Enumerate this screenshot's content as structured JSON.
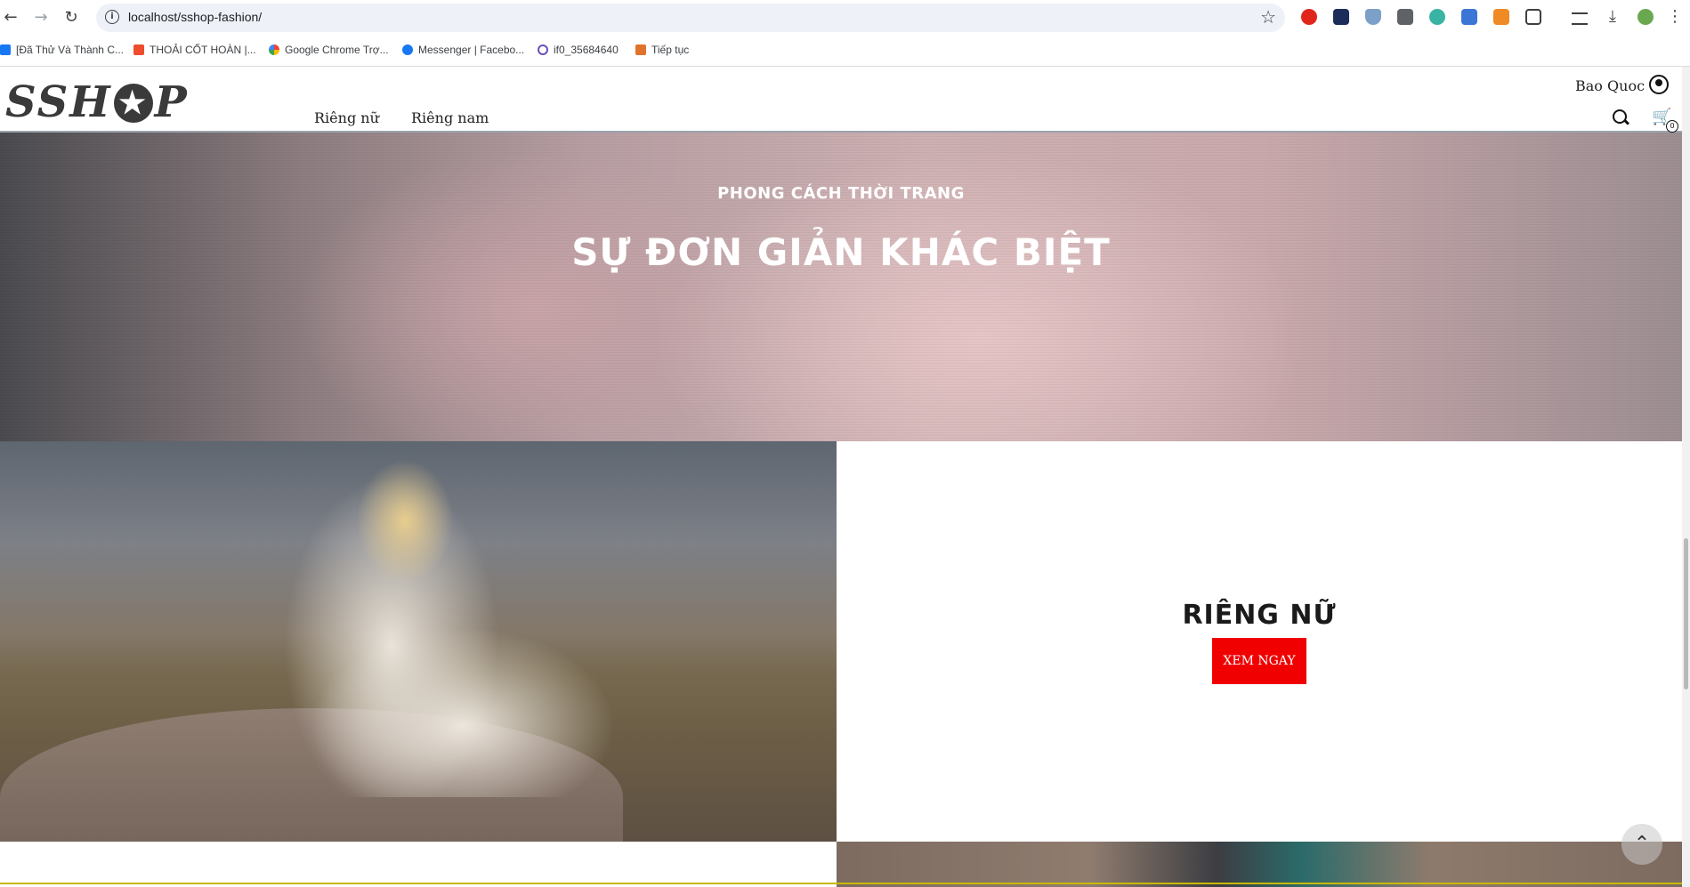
{
  "browser": {
    "url": "localhost/sshop-fashion/",
    "bookmarks": [
      {
        "label": "[Đã Thử Và Thành C...",
        "icon": "facebook-page-icon",
        "color": "#1877f2"
      },
      {
        "label": "THOẢI CỐT HOÀN |...",
        "icon": "shopee-icon",
        "color": "#ee4d2d"
      },
      {
        "label": "Google Chrome Trợ...",
        "icon": "google-icon",
        "color": "#4285f4"
      },
      {
        "label": "Messenger | Facebo...",
        "icon": "facebook-icon",
        "color": "#1877f2"
      },
      {
        "label": "if0_35684640",
        "icon": "infinity-icon",
        "color": "#6b4fbb"
      },
      {
        "label": "Tiếp tục",
        "icon": "bookmark-icon",
        "color": "#e0732c"
      }
    ]
  },
  "header": {
    "logo": {
      "left": "SSH",
      "right": "P"
    },
    "menu": [
      "Riêng nữ",
      "Riêng nam"
    ],
    "user_name": "Bao Quoc",
    "cart_count": "0"
  },
  "hero": {
    "subtitle": "PHONG CÁCH THỜI TRANG",
    "title": "SỰ ĐƠN GIẢN KHÁC BIỆT"
  },
  "women_section": {
    "title": "RIÊNG NỮ",
    "button": "XEM NGAY",
    "button_color": "#f00000"
  }
}
